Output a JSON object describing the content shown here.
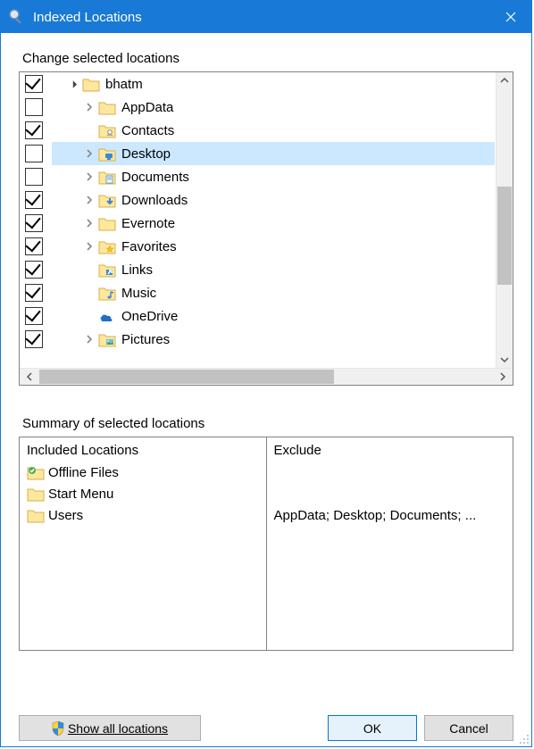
{
  "window": {
    "title": "Indexed Locations"
  },
  "labels": {
    "change_locations": "Change selected locations",
    "summary": "Summary of selected locations",
    "included_header": "Included Locations",
    "exclude_header": "Exclude"
  },
  "tree": {
    "items": [
      {
        "label": "bhatm",
        "checked": true,
        "expandable": true,
        "expanded": true,
        "selected": false,
        "indent": 0
      },
      {
        "label": "AppData",
        "checked": false,
        "expandable": true,
        "expanded": false,
        "selected": false,
        "indent": 1
      },
      {
        "label": "Contacts",
        "checked": true,
        "expandable": false,
        "expanded": false,
        "selected": false,
        "indent": 1,
        "icon": "contacts"
      },
      {
        "label": "Desktop",
        "checked": false,
        "expandable": true,
        "expanded": false,
        "selected": true,
        "indent": 1,
        "icon": "desktop"
      },
      {
        "label": "Documents",
        "checked": false,
        "expandable": true,
        "expanded": false,
        "selected": false,
        "indent": 1,
        "icon": "documents"
      },
      {
        "label": "Downloads",
        "checked": true,
        "expandable": true,
        "expanded": false,
        "selected": false,
        "indent": 1,
        "icon": "downloads"
      },
      {
        "label": "Evernote",
        "checked": true,
        "expandable": true,
        "expanded": false,
        "selected": false,
        "indent": 1
      },
      {
        "label": "Favorites",
        "checked": true,
        "expandable": true,
        "expanded": false,
        "selected": false,
        "indent": 1,
        "icon": "favorites"
      },
      {
        "label": "Links",
        "checked": true,
        "expandable": false,
        "expanded": false,
        "selected": false,
        "indent": 1,
        "icon": "links"
      },
      {
        "label": "Music",
        "checked": true,
        "expandable": false,
        "expanded": false,
        "selected": false,
        "indent": 1,
        "icon": "music"
      },
      {
        "label": "OneDrive",
        "checked": true,
        "expandable": false,
        "expanded": false,
        "selected": false,
        "indent": 1,
        "icon": "onedrive"
      },
      {
        "label": "Pictures",
        "checked": true,
        "expandable": true,
        "expanded": false,
        "selected": false,
        "indent": 1,
        "icon": "pictures"
      }
    ]
  },
  "summary": {
    "included": [
      {
        "label": "Offline Files",
        "icon": "offline-files"
      },
      {
        "label": "Start Menu",
        "icon": "folder"
      },
      {
        "label": "Users",
        "icon": "folder"
      }
    ],
    "exclude_rows": [
      "",
      "",
      "AppData; Desktop; Documents; ..."
    ]
  },
  "buttons": {
    "show_all": "Show all locations",
    "ok": "OK",
    "cancel": "Cancel"
  }
}
